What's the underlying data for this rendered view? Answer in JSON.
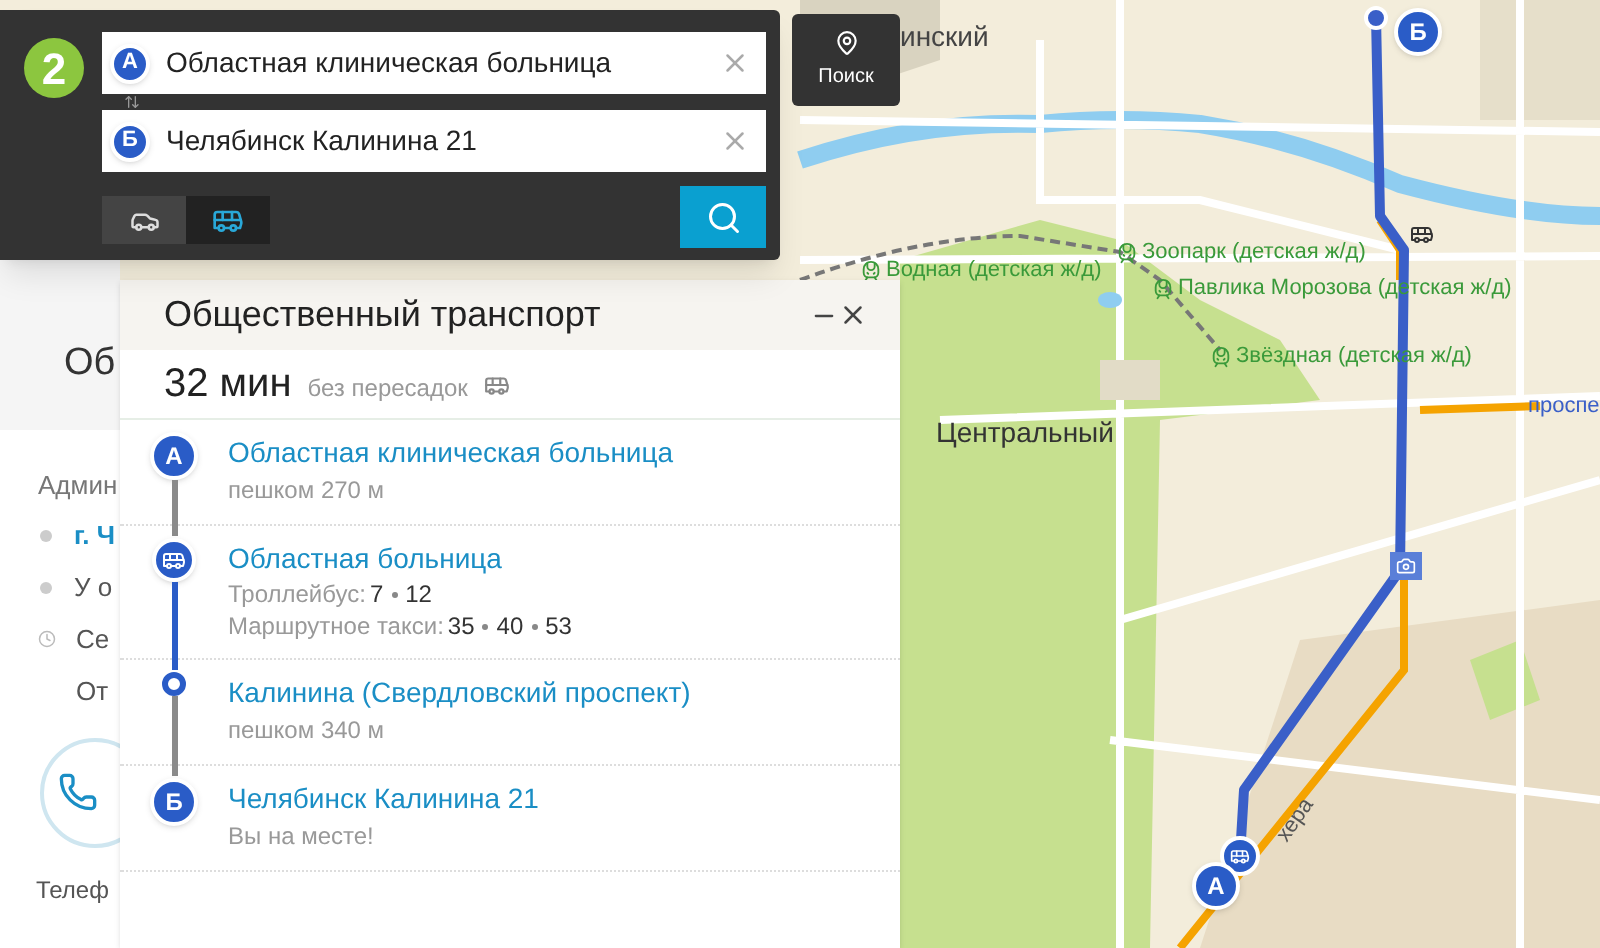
{
  "search_panel": {
    "logo": "2",
    "from": {
      "marker": "А",
      "value": "Областная клиническая больница"
    },
    "to": {
      "marker": "Б",
      "value": "Челябинск Калинина 21"
    },
    "modes": [
      {
        "kind": "car",
        "selected": false
      },
      {
        "kind": "bus",
        "selected": true
      }
    ]
  },
  "search_button": {
    "label": "Поиск"
  },
  "map_labels": [
    {
      "kind": "district",
      "text": "инский"
    },
    {
      "kind": "station",
      "text": "Водная (детская ж/д)"
    },
    {
      "kind": "station",
      "text": "Зоопарк (детская ж/д)"
    },
    {
      "kind": "station",
      "text": "Павлика Морозова (детская ж/д)"
    },
    {
      "kind": "station",
      "text": "Звёздная (детская ж/д)"
    },
    {
      "kind": "district",
      "text": "Центральный"
    },
    {
      "kind": "street",
      "text": "проспе"
    },
    {
      "kind": "street",
      "text": "хера"
    }
  ],
  "map_markers": [
    {
      "kind": "start",
      "text": "А"
    },
    {
      "kind": "end",
      "text": "Б"
    }
  ],
  "background_page": {
    "heading": "Об",
    "section": "Админ",
    "items": [
      {
        "kind": "link",
        "text": "г. Ч"
      },
      {
        "kind": "dot",
        "text": "У о"
      },
      {
        "kind": "clock",
        "text": "Се"
      },
      {
        "kind": "plain",
        "text": "От"
      }
    ],
    "phone_label": "Телеф"
  },
  "route_panel": {
    "title": "Общественный транспорт",
    "duration": "32 мин",
    "transfers": "без пересадок",
    "steps": [
      {
        "kind": "start",
        "marker": "А",
        "name": "Областная клиническая больница",
        "detail": "пешком 270 м"
      },
      {
        "kind": "transit",
        "name": "Областная больница",
        "lines": [
          {
            "label": "Троллейбус:",
            "numbers": [
              "7",
              "12"
            ]
          },
          {
            "label": "Маршрутное такси:",
            "numbers": [
              "35",
              "40",
              "53"
            ]
          }
        ]
      },
      {
        "kind": "stop",
        "name": "Калинина (Свердловский проспект)",
        "detail": "пешком 340 м"
      },
      {
        "kind": "end",
        "marker": "Б",
        "name": "Челябинск Калинина 21",
        "detail": "Вы на месте!"
      }
    ]
  }
}
